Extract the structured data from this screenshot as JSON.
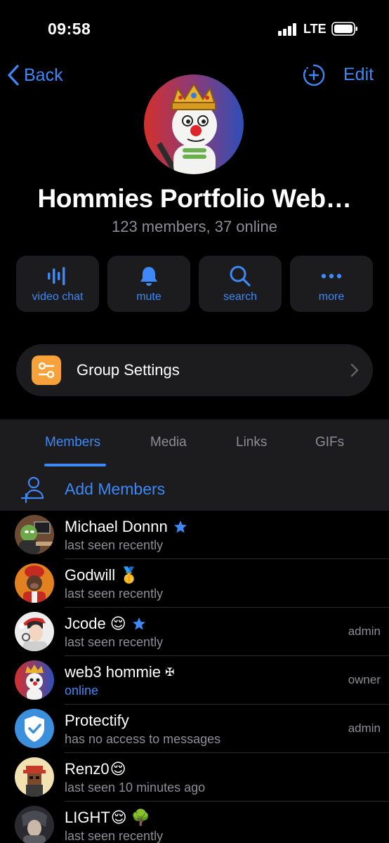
{
  "status_bar": {
    "time": "09:58",
    "network": "LTE"
  },
  "nav": {
    "back_label": "Back",
    "edit_label": "Edit"
  },
  "group": {
    "title": "Hommies Portfolio Web…",
    "subtitle": "123 members, 37 online"
  },
  "actions": [
    {
      "label": "video chat",
      "icon": "waveform-icon"
    },
    {
      "label": "mute",
      "icon": "bell-icon"
    },
    {
      "label": "search",
      "icon": "search-icon"
    },
    {
      "label": "more",
      "icon": "ellipsis-icon"
    }
  ],
  "settings": {
    "label": "Group Settings"
  },
  "tabs": [
    "Members",
    "Media",
    "Links",
    "GIFs"
  ],
  "active_tab": "Members",
  "add_members_label": "Add Members",
  "members": [
    {
      "name": "Michael Donnn",
      "status": "last seen recently",
      "role": "",
      "badge": "star",
      "emoji": ""
    },
    {
      "name": "Godwill",
      "status": "last seen recently",
      "role": "",
      "badge": "",
      "emoji": "🥇"
    },
    {
      "name": "Jcode",
      "status": "last seen recently",
      "role": "admin",
      "badge": "star",
      "emoji": "😌"
    },
    {
      "name": "web3 hommie",
      "status": "online",
      "role": "owner",
      "badge": "",
      "emoji": "✠"
    },
    {
      "name": "Protectify",
      "status": "has no access to messages",
      "role": "admin",
      "badge": "",
      "emoji": ""
    },
    {
      "name": "Renz0",
      "status": "last seen 10 minutes ago",
      "role": "",
      "badge": "",
      "emoji": "😌"
    },
    {
      "name": "LIGHT",
      "status": "last seen recently",
      "role": "",
      "badge": "",
      "emoji": "😌 🌳"
    }
  ],
  "colors": {
    "accent": "#3e88f7",
    "background": "#000000",
    "surface": "#1c1c1e",
    "settings_icon": "#f7a13a",
    "secondary_text": "#8e8e93"
  }
}
